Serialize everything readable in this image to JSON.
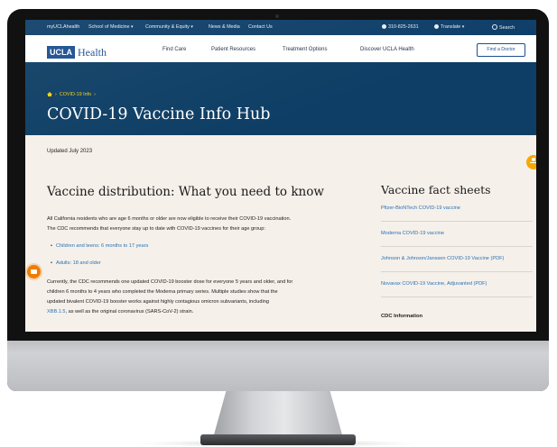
{
  "topbar": {
    "links": [
      "myUCLAhealth",
      "School of Medicine",
      "Community & Equity",
      "News & Media",
      "Contact Us"
    ],
    "phone": "310-825-2631",
    "translate": "Translate",
    "search": "Search"
  },
  "logo": {
    "ucla": "UCLA",
    "health": "Health"
  },
  "nav": {
    "items": [
      "Find Care",
      "Patient Resources",
      "Treatment Options",
      "Discover UCLA Health"
    ],
    "cta": "Find a Doctor"
  },
  "hero": {
    "breadcrumb": "COVID-19 Info",
    "title": "COVID-19 Vaccine Info Hub"
  },
  "main": {
    "updated": "Updated July 2023",
    "section_title": "Vaccine distribution: What you need to know",
    "para1_line1": "All California residents who are age 6 months or older are now eligible to receive their COVID-19 vaccination.",
    "para1_line2": "The CDC recommends that everyone stay up to date with COVID-19 vaccines for their age group:",
    "bullets": [
      "Children and teens: 6 months to 17 years",
      "Adults: 18 and older"
    ],
    "para2_line1": "Currently, the CDC recommends one updated COVID-19 booster dose for everyone 5 years and older, and for",
    "para2_line2": "children 6 months to 4 years who completed the Moderna primary series. Multiple studies show that the",
    "para2_line3": "updated bivalent COVID-19 booster works against highly contagious omicron subvariants, including",
    "para2_link": "XBB.1.5",
    "para2_line4_rest": ", as well as the original coronavirus (SARS-CoV-2) strain."
  },
  "sidebar": {
    "title": "Vaccine fact sheets",
    "links": [
      "Pfizer-BioNTech COVID-19 vaccine",
      "Moderna COVID-19 vaccine",
      "Johnson & Johnson/Janssen COVID-19 Vaccine (PDF)",
      "Novavax COVID-19 Vaccine, Adjuvanted (PDF)"
    ],
    "cdc_heading": "CDC Information"
  },
  "colors": {
    "brand_blue": "#0e3e65",
    "link_blue": "#2a72b5",
    "accent_yellow": "#ffd100",
    "accessibility_orange": "#f7a800",
    "chat_orange": "#f07c00"
  },
  "icons": [
    "home-icon",
    "phone-icon",
    "globe-icon",
    "search-icon",
    "accessibility-icon",
    "chat-icon",
    "chevron-down-icon"
  ]
}
